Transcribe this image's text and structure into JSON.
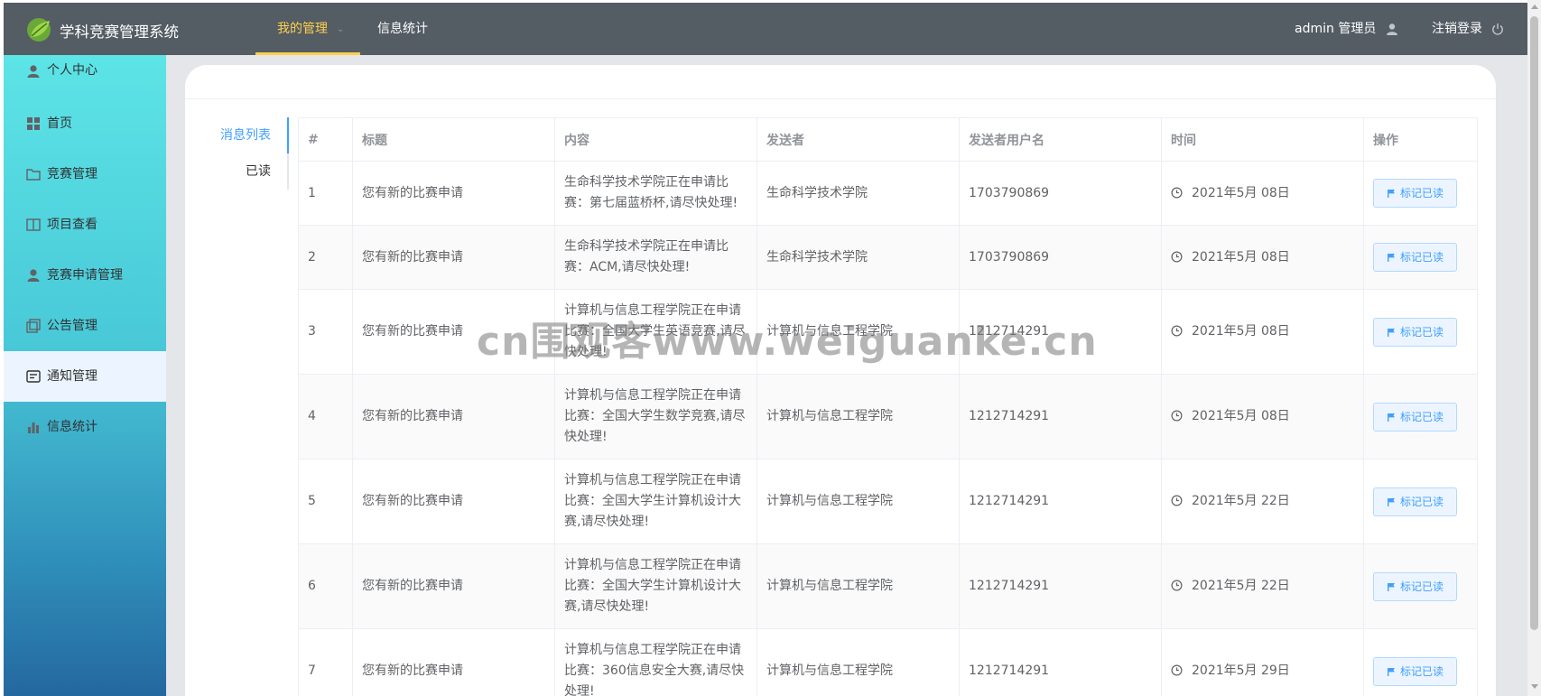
{
  "header": {
    "brand": "学科竞赛管理系统",
    "nav": [
      {
        "label": "我的管理",
        "active": true
      },
      {
        "label": "信息统计",
        "active": false
      }
    ],
    "user_label": "admin 管理员",
    "logout_label": "注销登录",
    "accent_color": "#ffd04b",
    "bg_color": "#545c64"
  },
  "sidebar": {
    "items": [
      {
        "label": "个人中心",
        "icon": "user-icon"
      },
      {
        "label": "首页",
        "icon": "grid-icon"
      },
      {
        "label": "竞赛管理",
        "icon": "folder-icon"
      },
      {
        "label": "项目查看",
        "icon": "book-icon"
      },
      {
        "label": "竞赛申请管理",
        "icon": "user-icon"
      },
      {
        "label": "公告管理",
        "icon": "copy-icon"
      },
      {
        "label": "通知管理",
        "icon": "message-icon",
        "active": true
      },
      {
        "label": "信息统计",
        "icon": "chart-icon"
      }
    ]
  },
  "tabs": {
    "items": [
      "消息列表",
      "已读"
    ],
    "active": "消息列表"
  },
  "table": {
    "headers": [
      "#",
      "标题",
      "内容",
      "发送者",
      "发送者用户名",
      "时间",
      "操作"
    ],
    "action_label": "标记已读",
    "rows": [
      {
        "index": "1",
        "title": "您有新的比赛申请",
        "content": "生命科学技术学院正在申请比赛：第七届蓝桥杯,请尽快处理!",
        "sender": "生命科学技术学院",
        "username": "1703790869",
        "time": "2021年5月 08日"
      },
      {
        "index": "2",
        "title": "您有新的比赛申请",
        "content": "生命科学技术学院正在申请比赛：ACM,请尽快处理!",
        "sender": "生命科学技术学院",
        "username": "1703790869",
        "time": "2021年5月 08日"
      },
      {
        "index": "3",
        "title": "您有新的比赛申请",
        "content": "计算机与信息工程学院正在申请比赛：全国大学生英语竞赛,请尽快处理!",
        "sender": "计算机与信息工程学院",
        "username": "1212714291",
        "time": "2021年5月 08日"
      },
      {
        "index": "4",
        "title": "您有新的比赛申请",
        "content": "计算机与信息工程学院正在申请比赛：全国大学生数学竞赛,请尽快处理!",
        "sender": "计算机与信息工程学院",
        "username": "1212714291",
        "time": "2021年5月 08日"
      },
      {
        "index": "5",
        "title": "您有新的比赛申请",
        "content": "计算机与信息工程学院正在申请比赛：全国大学生计算机设计大赛,请尽快处理!",
        "sender": "计算机与信息工程学院",
        "username": "1212714291",
        "time": "2021年5月 22日"
      },
      {
        "index": "6",
        "title": "您有新的比赛申请",
        "content": "计算机与信息工程学院正在申请比赛：全国大学生计算机设计大赛,请尽快处理!",
        "sender": "计算机与信息工程学院",
        "username": "1212714291",
        "time": "2021年5月 22日"
      },
      {
        "index": "7",
        "title": "您有新的比赛申请",
        "content": "计算机与信息工程学院正在申请比赛：360信息安全大赛,请尽快处理!",
        "sender": "计算机与信息工程学院",
        "username": "1212714291",
        "time": "2021年5月 29日"
      }
    ]
  },
  "watermark": "cn围观客www.weiguanke.cn"
}
